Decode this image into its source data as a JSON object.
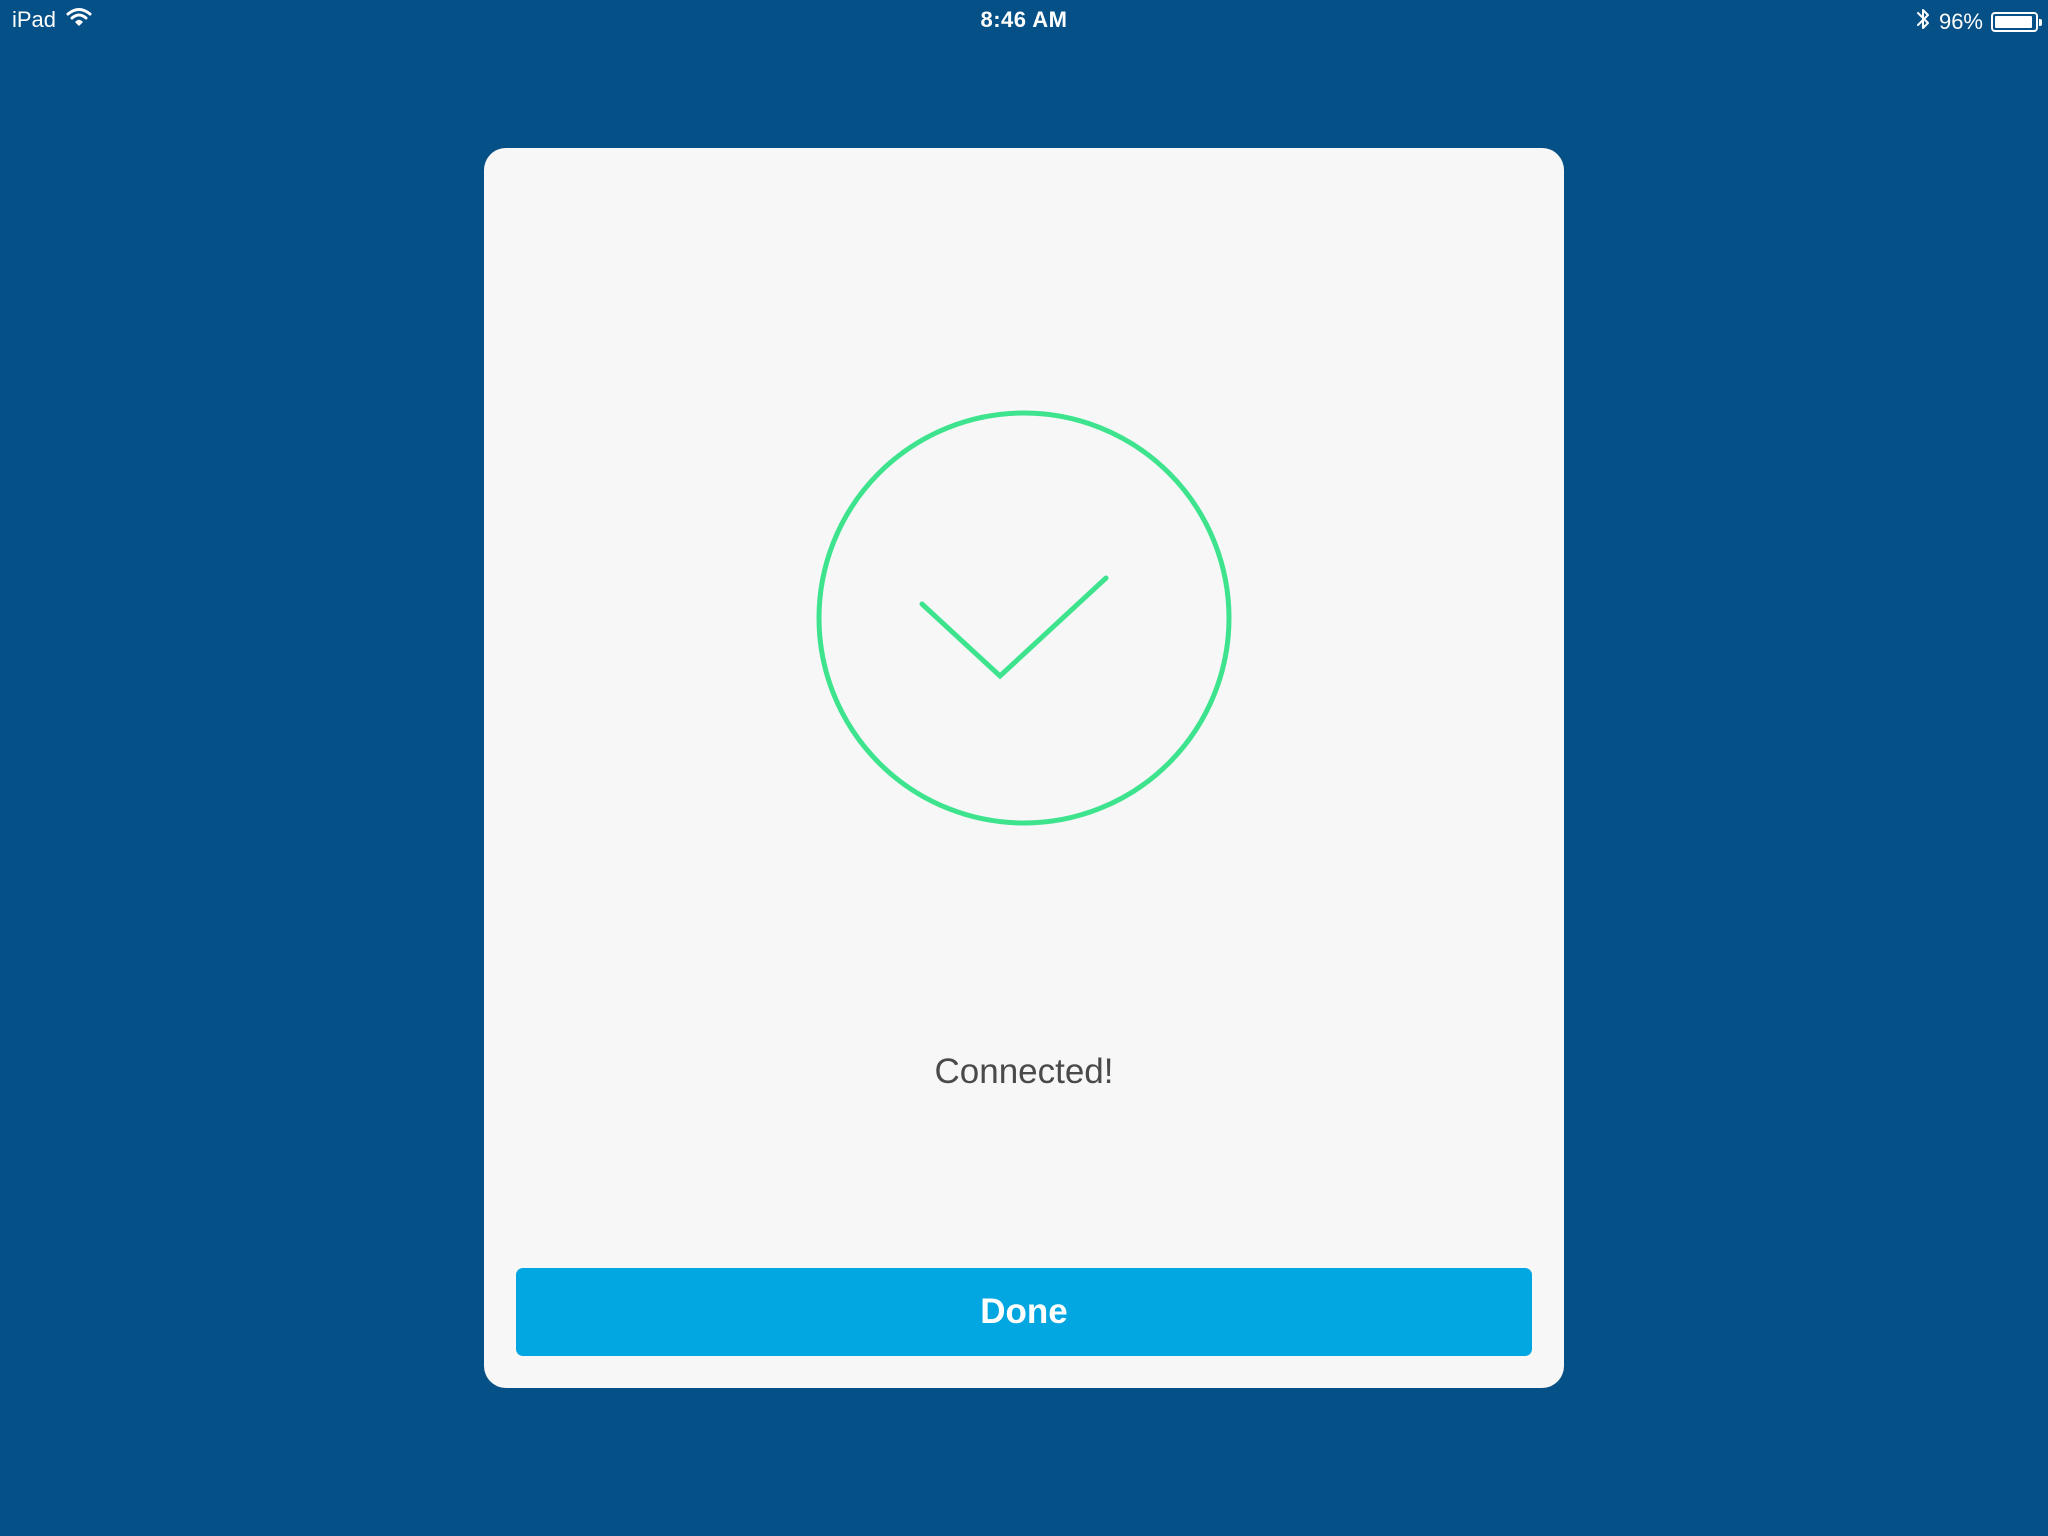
{
  "status_bar": {
    "device": "iPad",
    "time": "8:46 AM",
    "battery_percent": "96%",
    "battery_level": 0.96,
    "icons": [
      "wifi-icon",
      "bluetooth-icon",
      "battery-icon"
    ]
  },
  "dialog": {
    "icon": "check-circle-icon",
    "message": "Connected!",
    "done_label": "Done"
  },
  "colors": {
    "background": "#045087",
    "card": "#f7f7f7",
    "success": "#3ee38e",
    "button": "#02a6e0",
    "text": "#4a4a4a"
  }
}
